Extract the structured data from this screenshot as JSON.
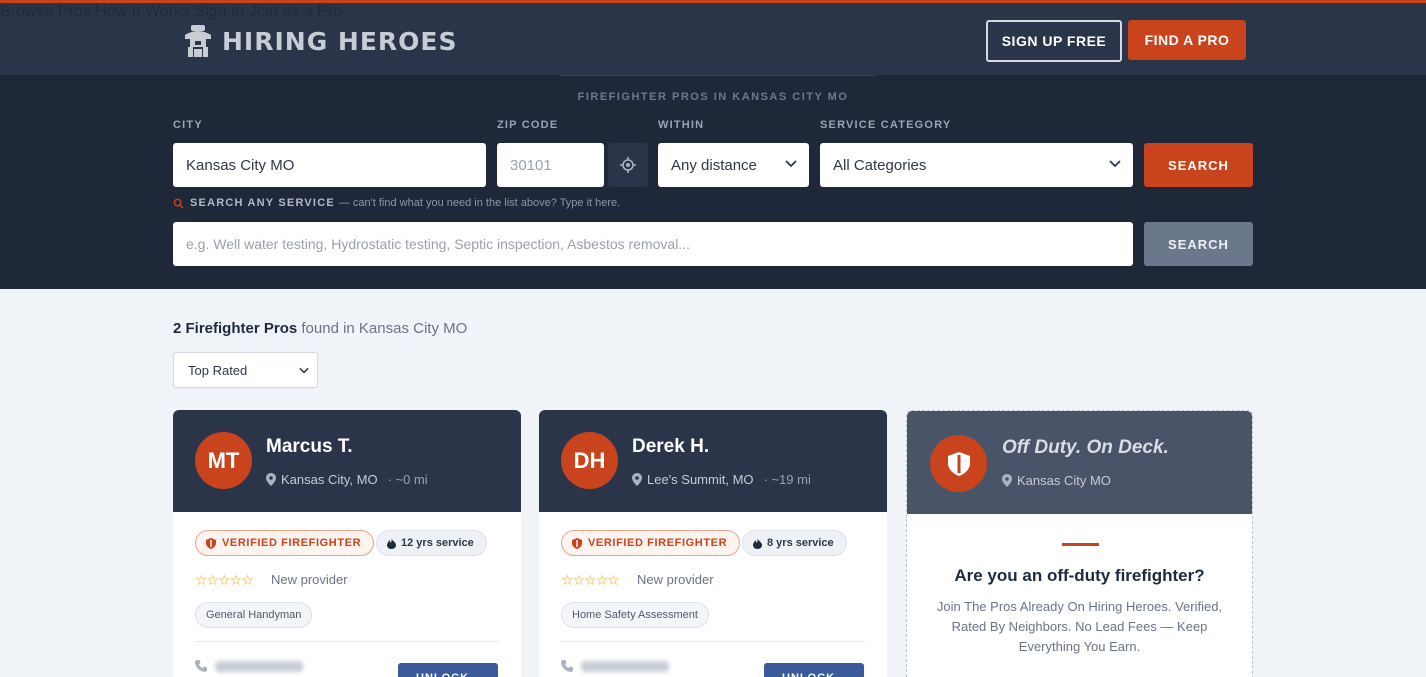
{
  "header": {
    "brand": "HIRING HEROES",
    "nav": [
      "Browse Pros",
      "How It Works",
      "Sign In",
      "Join as a Pro"
    ],
    "signup_label": "SIGN UP FREE",
    "find_label": "FIND A PRO",
    "accent": "#c9441d"
  },
  "search": {
    "title": "FIREFIGHTER PROS IN KANSAS CITY MO",
    "city_label": "CITY",
    "city_value": "Kansas City MO",
    "zip_label": "ZIP CODE",
    "zip_placeholder": "30101",
    "within_label": "WITHIN",
    "within_value": "Any distance",
    "category_label": "SERVICE CATEGORY",
    "category_value": "All Categories",
    "search_label": "SEARCH",
    "any_service_label": "SEARCH ANY SERVICE",
    "any_service_hint": "— can't find what you need in the list above? Type it here.",
    "any_service_placeholder": "e.g. Well water testing, Hydrostatic testing, Septic inspection, Asbestos removal...",
    "search2_label": "SEARCH"
  },
  "results": {
    "count_text": "2 Firefighter Pros",
    "found_text": "found in Kansas City MO",
    "sort_value": "Top Rated"
  },
  "pros": [
    {
      "initials": "MT",
      "name": "Marcus T.",
      "location": "Kansas City, MO",
      "distance": "· ~0 mi",
      "verified": "VERIFIED FIREFIGHTER",
      "service": "12 yrs service",
      "stars": "☆☆☆☆☆",
      "rating_text": "New provider",
      "tag": "General Handyman",
      "unlock": "UNLOCK"
    },
    {
      "initials": "DH",
      "name": "Derek H.",
      "location": "Lee's Summit, MO",
      "distance": "· ~19 mi",
      "verified": "VERIFIED FIREFIGHTER",
      "service": "8 yrs service",
      "stars": "☆☆☆☆☆",
      "rating_text": "New provider",
      "tag": "Home Safety Assessment",
      "unlock": "UNLOCK"
    }
  ],
  "promo": {
    "title": "Off Duty. On Deck.",
    "location": "Kansas City MO",
    "question": "Are you an off-duty firefighter?",
    "body": "Join The Pros Already On Hiring Heroes. Verified, Rated By Neighbors. No Lead Fees — Keep Everything You Earn."
  }
}
